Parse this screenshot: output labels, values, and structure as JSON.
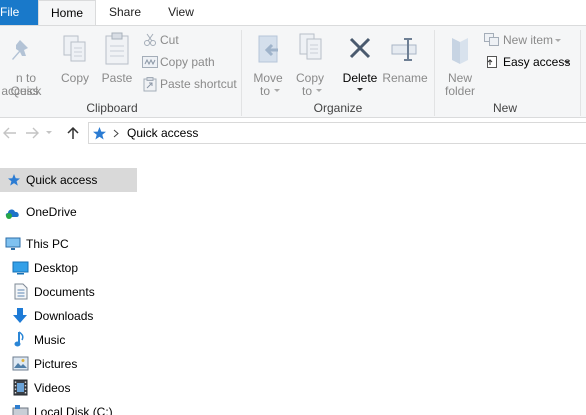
{
  "tabs": {
    "file": "File",
    "home": "Home",
    "share": "Share",
    "view": "View"
  },
  "clipboard": {
    "pin_label_line1": "n to Quick",
    "pin_label_line2": "access",
    "copy": "Copy",
    "paste": "Paste",
    "cut": "Cut",
    "copy_path": "Copy path",
    "paste_shortcut": "Paste shortcut",
    "group": "Clipboard"
  },
  "organize": {
    "move_to_line1": "Move",
    "move_to_line2": "to",
    "copy_to_line1": "Copy",
    "copy_to_line2": "to",
    "delete": "Delete",
    "rename": "Rename",
    "group": "Organize"
  },
  "new": {
    "new_folder_line1": "New",
    "new_folder_line2": "folder",
    "new_item": "New item",
    "easy_access": "Easy access",
    "group": "New"
  },
  "address": {
    "location": "Quick access"
  },
  "nav": {
    "quick_access": "Quick access",
    "onedrive": "OneDrive",
    "this_pc": "This PC",
    "desktop": "Desktop",
    "documents": "Documents",
    "downloads": "Downloads",
    "music": "Music",
    "pictures": "Pictures",
    "videos": "Videos",
    "local_disk": "Local Disk (C:)"
  }
}
